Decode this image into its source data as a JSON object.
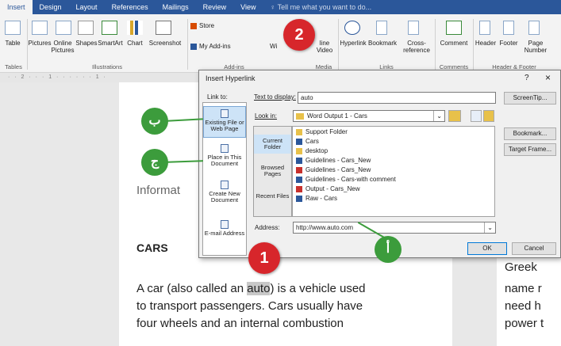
{
  "tabs": [
    "Insert",
    "Design",
    "Layout",
    "References",
    "Mailings",
    "Review",
    "View"
  ],
  "tell_me": "Tell me what you want to do...",
  "ribbon": {
    "table": "Table",
    "pictures": "Pictures",
    "online_pictures": "Online Pictures",
    "shapes": "Shapes",
    "smartart": "SmartArt",
    "chart": "Chart",
    "screenshot": "Screenshot",
    "store": "Store",
    "my_addins": "My Add-ins",
    "wiki": "Wi",
    "online_video": "line Video",
    "hyperlink": "Hyperlink",
    "bookmark": "Bookmark",
    "cross_reference": "Cross-reference",
    "comment": "Comment",
    "header": "Header",
    "footer": "Footer",
    "page_number": "Page Number",
    "groups": {
      "tables": "Tables",
      "illustrations": "Illustrations",
      "addins": "Add-ins",
      "media": "Media",
      "links": "Links",
      "comments": "Comments",
      "header_footer": "Header & Footer"
    }
  },
  "ruler": "· · 2 · · · 1 · · · · · · 1 ·",
  "document": {
    "heading_partial": "Informat",
    "cars_heading": "CARS",
    "para_line1_a": "A car (also called an ",
    "para_highlight": "auto",
    "para_line1_b": ") is a vehicle used",
    "para_line2": "to transport passengers. Cars usually have",
    "para_line3": "four wheels and an internal combustion",
    "right_col": [
      "Greek",
      "name r",
      "need h",
      "power t"
    ]
  },
  "dialog": {
    "title": "Insert Hyperlink",
    "help": "?",
    "close": "×",
    "link_to": "Link to:",
    "text_to_display_label": "Text to display:",
    "text_to_display": "auto",
    "screentip": "ScreenTip...",
    "look_in_label": "Look in:",
    "look_in": "Word Output 1 - Cars",
    "link_options": [
      "Existing File or Web Page",
      "Place in This Document",
      "Create New Document",
      "E-mail Address"
    ],
    "inner_tabs": [
      "Current Folder",
      "Browsed Pages",
      "Recent Files"
    ],
    "files": [
      "Support Folder",
      "Cars",
      "desktop",
      "Guidelines - Cars_New",
      "Guidelines - Cars_New",
      "Guidelines - Cars-with comment",
      "Output - Cars_New",
      "Raw - Cars"
    ],
    "bookmark": "Bookmark...",
    "target_frame": "Target Frame...",
    "address_label": "Address:",
    "address": "http://www.auto.com",
    "ok": "OK",
    "cancel": "Cancel"
  },
  "badges": {
    "one": "1",
    "two": "2",
    "alef": "أ",
    "ba": "ب",
    "jeem": "ج"
  }
}
